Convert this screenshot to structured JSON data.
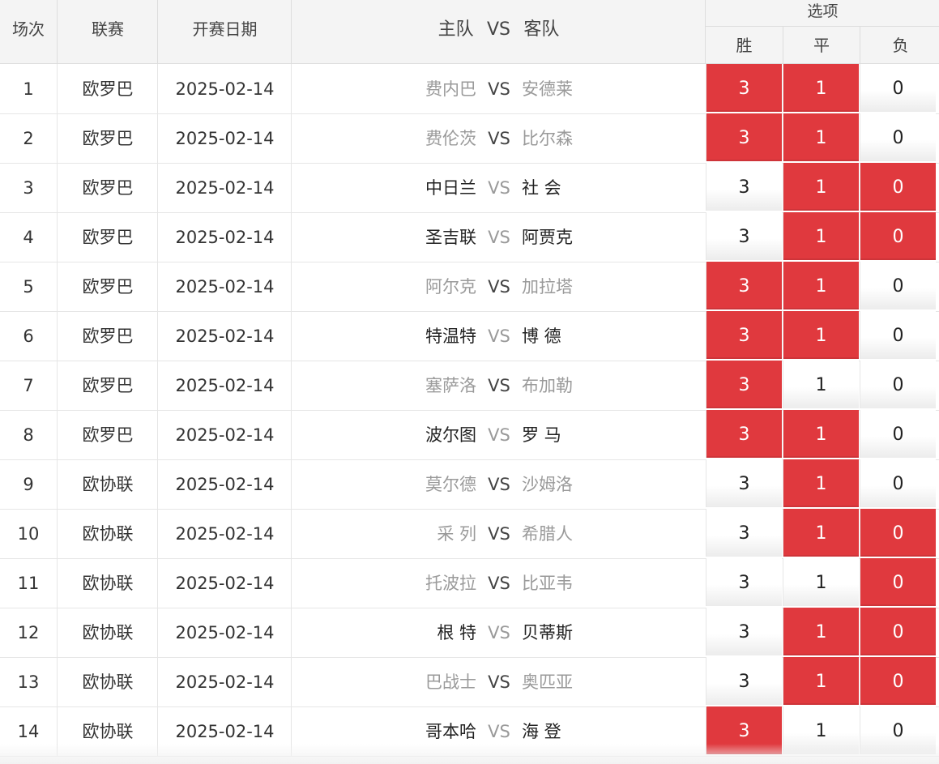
{
  "header": {
    "col_index": "场次",
    "col_league": "联赛",
    "col_date": "开赛日期",
    "col_match_home": "主队",
    "col_match_vs": "VS",
    "col_match_away": "客队",
    "col_options": "选项",
    "opt_win": "胜",
    "opt_draw": "平",
    "opt_loss": "负"
  },
  "rows": [
    {
      "idx": "1",
      "league": "欧罗巴",
      "date": "2025-02-14",
      "home": "费内巴",
      "vs": "VS",
      "away": "安德莱",
      "dim_side": "teams",
      "win": "3",
      "draw": "1",
      "loss": "0",
      "sel": [
        true,
        true,
        false
      ]
    },
    {
      "idx": "2",
      "league": "欧罗巴",
      "date": "2025-02-14",
      "home": "费伦茨",
      "vs": "VS",
      "away": "比尔森",
      "dim_side": "teams",
      "win": "3",
      "draw": "1",
      "loss": "0",
      "sel": [
        true,
        true,
        false
      ]
    },
    {
      "idx": "3",
      "league": "欧罗巴",
      "date": "2025-02-14",
      "home": "中日兰",
      "vs": "VS",
      "away": "社 会",
      "dim_side": "vs",
      "win": "3",
      "draw": "1",
      "loss": "0",
      "sel": [
        false,
        true,
        true
      ]
    },
    {
      "idx": "4",
      "league": "欧罗巴",
      "date": "2025-02-14",
      "home": "圣吉联",
      "vs": "VS",
      "away": "阿贾克",
      "dim_side": "vs",
      "win": "3",
      "draw": "1",
      "loss": "0",
      "sel": [
        false,
        true,
        true
      ]
    },
    {
      "idx": "5",
      "league": "欧罗巴",
      "date": "2025-02-14",
      "home": "阿尔克",
      "vs": "VS",
      "away": "加拉塔",
      "dim_side": "teams",
      "win": "3",
      "draw": "1",
      "loss": "0",
      "sel": [
        true,
        true,
        false
      ]
    },
    {
      "idx": "6",
      "league": "欧罗巴",
      "date": "2025-02-14",
      "home": "特温特",
      "vs": "VS",
      "away": "博 德",
      "dim_side": "vs",
      "win": "3",
      "draw": "1",
      "loss": "0",
      "sel": [
        true,
        true,
        false
      ]
    },
    {
      "idx": "7",
      "league": "欧罗巴",
      "date": "2025-02-14",
      "home": "塞萨洛",
      "vs": "VS",
      "away": "布加勒",
      "dim_side": "teams",
      "win": "3",
      "draw": "1",
      "loss": "0",
      "sel": [
        true,
        false,
        false
      ]
    },
    {
      "idx": "8",
      "league": "欧罗巴",
      "date": "2025-02-14",
      "home": "波尔图",
      "vs": "VS",
      "away": "罗 马",
      "dim_side": "vs",
      "win": "3",
      "draw": "1",
      "loss": "0",
      "sel": [
        true,
        true,
        false
      ]
    },
    {
      "idx": "9",
      "league": "欧协联",
      "date": "2025-02-14",
      "home": "莫尔德",
      "vs": "VS",
      "away": "沙姆洛",
      "dim_side": "teams",
      "win": "3",
      "draw": "1",
      "loss": "0",
      "sel": [
        false,
        true,
        false
      ]
    },
    {
      "idx": "10",
      "league": "欧协联",
      "date": "2025-02-14",
      "home": "采 列",
      "vs": "VS",
      "away": "希腊人",
      "dim_side": "teams",
      "win": "3",
      "draw": "1",
      "loss": "0",
      "sel": [
        false,
        true,
        true
      ]
    },
    {
      "idx": "11",
      "league": "欧协联",
      "date": "2025-02-14",
      "home": "托波拉",
      "vs": "VS",
      "away": "比亚韦",
      "dim_side": "teams",
      "win": "3",
      "draw": "1",
      "loss": "0",
      "sel": [
        false,
        false,
        true
      ]
    },
    {
      "idx": "12",
      "league": "欧协联",
      "date": "2025-02-14",
      "home": "根 特",
      "vs": "VS",
      "away": "贝蒂斯",
      "dim_side": "vs",
      "win": "3",
      "draw": "1",
      "loss": "0",
      "sel": [
        false,
        true,
        true
      ]
    },
    {
      "idx": "13",
      "league": "欧协联",
      "date": "2025-02-14",
      "home": "巴战士",
      "vs": "VS",
      "away": "奥匹亚",
      "dim_side": "teams",
      "win": "3",
      "draw": "1",
      "loss": "0",
      "sel": [
        false,
        true,
        true
      ]
    },
    {
      "idx": "14",
      "league": "欧协联",
      "date": "2025-02-14",
      "home": "哥本哈",
      "vs": "VS",
      "away": "海 登",
      "dim_side": "vs",
      "win": "3",
      "draw": "1",
      "loss": "0",
      "sel": [
        true,
        false,
        false
      ]
    }
  ],
  "colors": {
    "selected_bg": "#e0393e",
    "selected_text": "#ffffff",
    "header_bg": "#f4f4f4",
    "dim_text": "#9a9a9a"
  }
}
